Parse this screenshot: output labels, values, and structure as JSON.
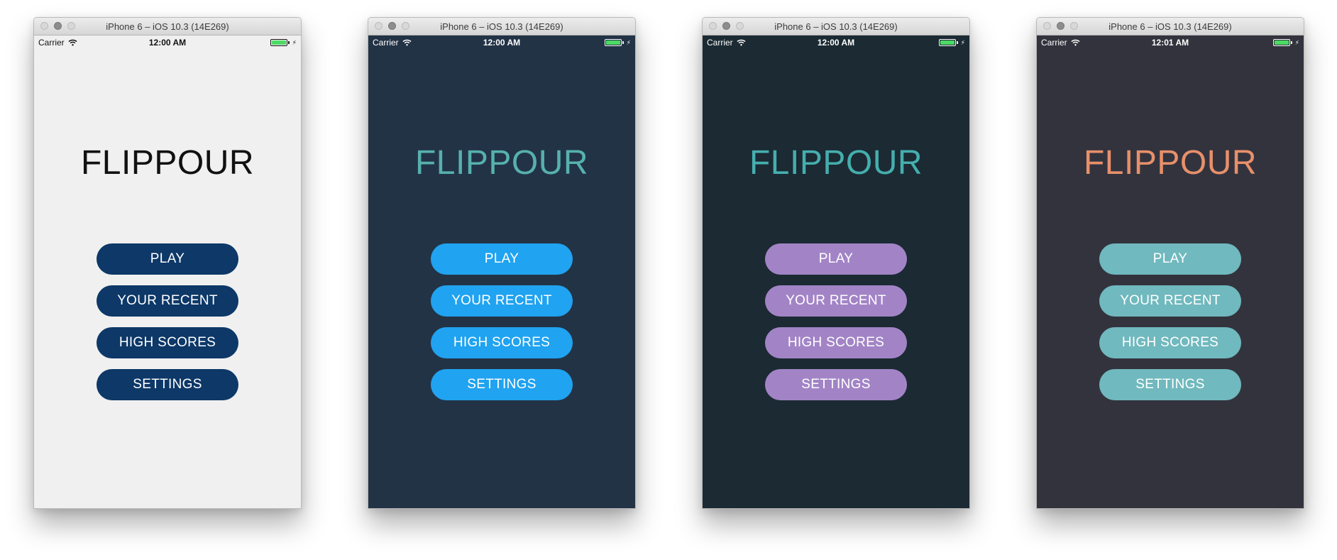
{
  "simulators": [
    {
      "window_title": "iPhone 6 – iOS 10.3 (14E269)",
      "carrier": "Carrier",
      "time": "12:00 AM",
      "app_title": "FLIPPOUR",
      "buttons": [
        "PLAY",
        "YOUR RECENT",
        "HIGH SCORES",
        "SETTINGS"
      ],
      "colors": {
        "background": "#f0f0f0",
        "title": "#111111",
        "button": "#0d3868",
        "status_text": "#111111"
      }
    },
    {
      "window_title": "iPhone 6 – iOS 10.3 (14E269)",
      "carrier": "Carrier",
      "time": "12:00 AM",
      "app_title": "FLIPPOUR",
      "buttons": [
        "PLAY",
        "YOUR RECENT",
        "HIGH SCORES",
        "SETTINGS"
      ],
      "colors": {
        "background": "#233346",
        "title": "#56b1ad",
        "button": "#20a3f0",
        "status_text": "#ffffff"
      }
    },
    {
      "window_title": "iPhone 6 – iOS 10.3 (14E269)",
      "carrier": "Carrier",
      "time": "12:00 AM",
      "app_title": "FLIPPOUR",
      "buttons": [
        "PLAY",
        "YOUR RECENT",
        "HIGH SCORES",
        "SETTINGS"
      ],
      "colors": {
        "background": "#1b2a33",
        "title": "#45aeae",
        "button": "#a284c6",
        "status_text": "#ffffff"
      }
    },
    {
      "window_title": "iPhone 6 – iOS 10.3 (14E269)",
      "carrier": "Carrier",
      "time": "12:01 AM",
      "app_title": "FLIPPOUR",
      "buttons": [
        "PLAY",
        "YOUR RECENT",
        "HIGH SCORES",
        "SETTINGS"
      ],
      "colors": {
        "background": "#33333e",
        "title": "#e8906a",
        "button": "#70b9be",
        "status_text": "#ffffff"
      }
    }
  ]
}
